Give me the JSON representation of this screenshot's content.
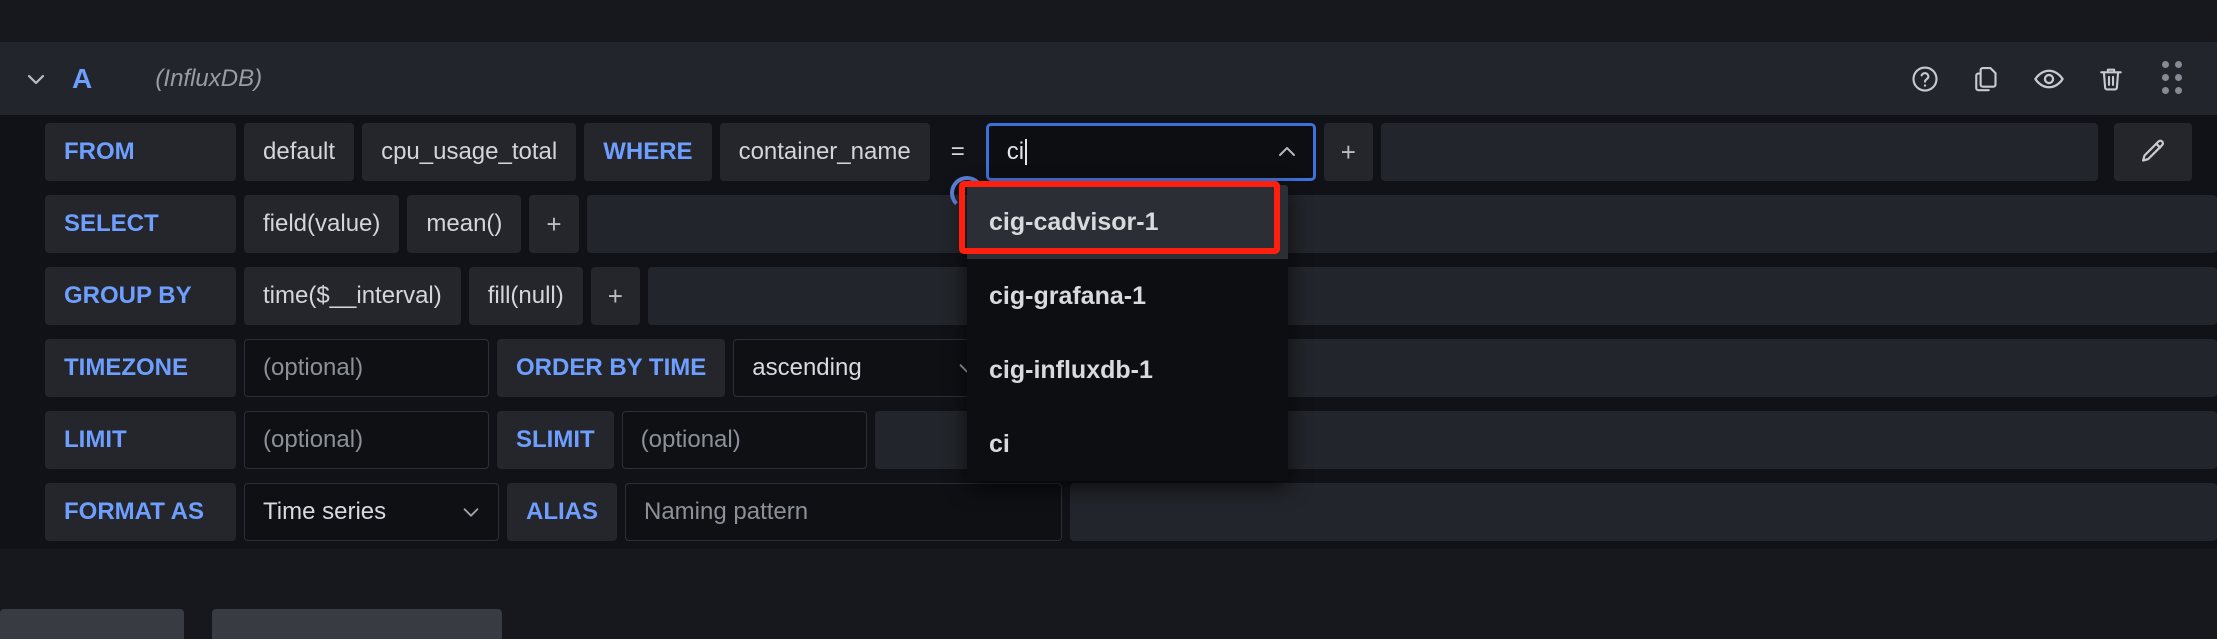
{
  "header": {
    "ref_id": "A",
    "datasource": "(InfluxDB)",
    "collapse_icon": "chevron-down-icon",
    "icons": [
      {
        "name": "help-icon",
        "title": "Show data source help"
      },
      {
        "name": "duplicate-icon",
        "title": "Duplicate query"
      },
      {
        "name": "eye-icon",
        "title": "Disable/enable query"
      },
      {
        "name": "trash-icon",
        "title": "Remove query"
      },
      {
        "name": "drag-handle-icon",
        "title": "Drag and drop to reorder"
      }
    ]
  },
  "colors": {
    "accent_blue": "#6e9fff",
    "focus_blue": "#3d71d9",
    "annotation_red": "#ff1f0f",
    "panel_bg": "#22252b",
    "segment_bg": "#24262c",
    "input_bg": "#0e1014",
    "page_bg": "#111217",
    "text": "#d3d5da",
    "muted_text": "#8c9099"
  },
  "rows": {
    "from": {
      "label": "FROM",
      "policy": "default",
      "measurement": "cpu_usage_total",
      "where_keyword": "WHERE",
      "tag_key": "container_name",
      "operator": "=",
      "tag_value": "ci",
      "add_label": "+",
      "edit_icon": "pencil-icon"
    },
    "select": {
      "label": "SELECT",
      "field": "field(value)",
      "aggregation": "mean()",
      "add_label": "+"
    },
    "group_by": {
      "label": "GROUP BY",
      "time": "time($__interval)",
      "fill": "fill(null)",
      "add_label": "+"
    },
    "timezone": {
      "label": "TIMEZONE",
      "placeholder": "(optional)",
      "value": "",
      "order_by_label": "ORDER BY TIME",
      "order_value": "ascending"
    },
    "limit": {
      "label": "LIMIT",
      "placeholder": "(optional)",
      "value": "",
      "slimit_label": "SLIMIT",
      "slimit_placeholder": "(optional)",
      "slimit_value": ""
    },
    "format_as": {
      "label": "FORMAT AS",
      "value": "Time series",
      "alias_label": "ALIAS",
      "alias_placeholder": "Naming pattern",
      "alias_value": ""
    }
  },
  "dropdown": {
    "open": true,
    "query_text": "ci",
    "highlighted_index": 0,
    "options": [
      {
        "label": "cig-cadvisor-1"
      },
      {
        "label": "cig-grafana-1"
      },
      {
        "label": "cig-influxdb-1"
      },
      {
        "label": "ci"
      }
    ]
  }
}
